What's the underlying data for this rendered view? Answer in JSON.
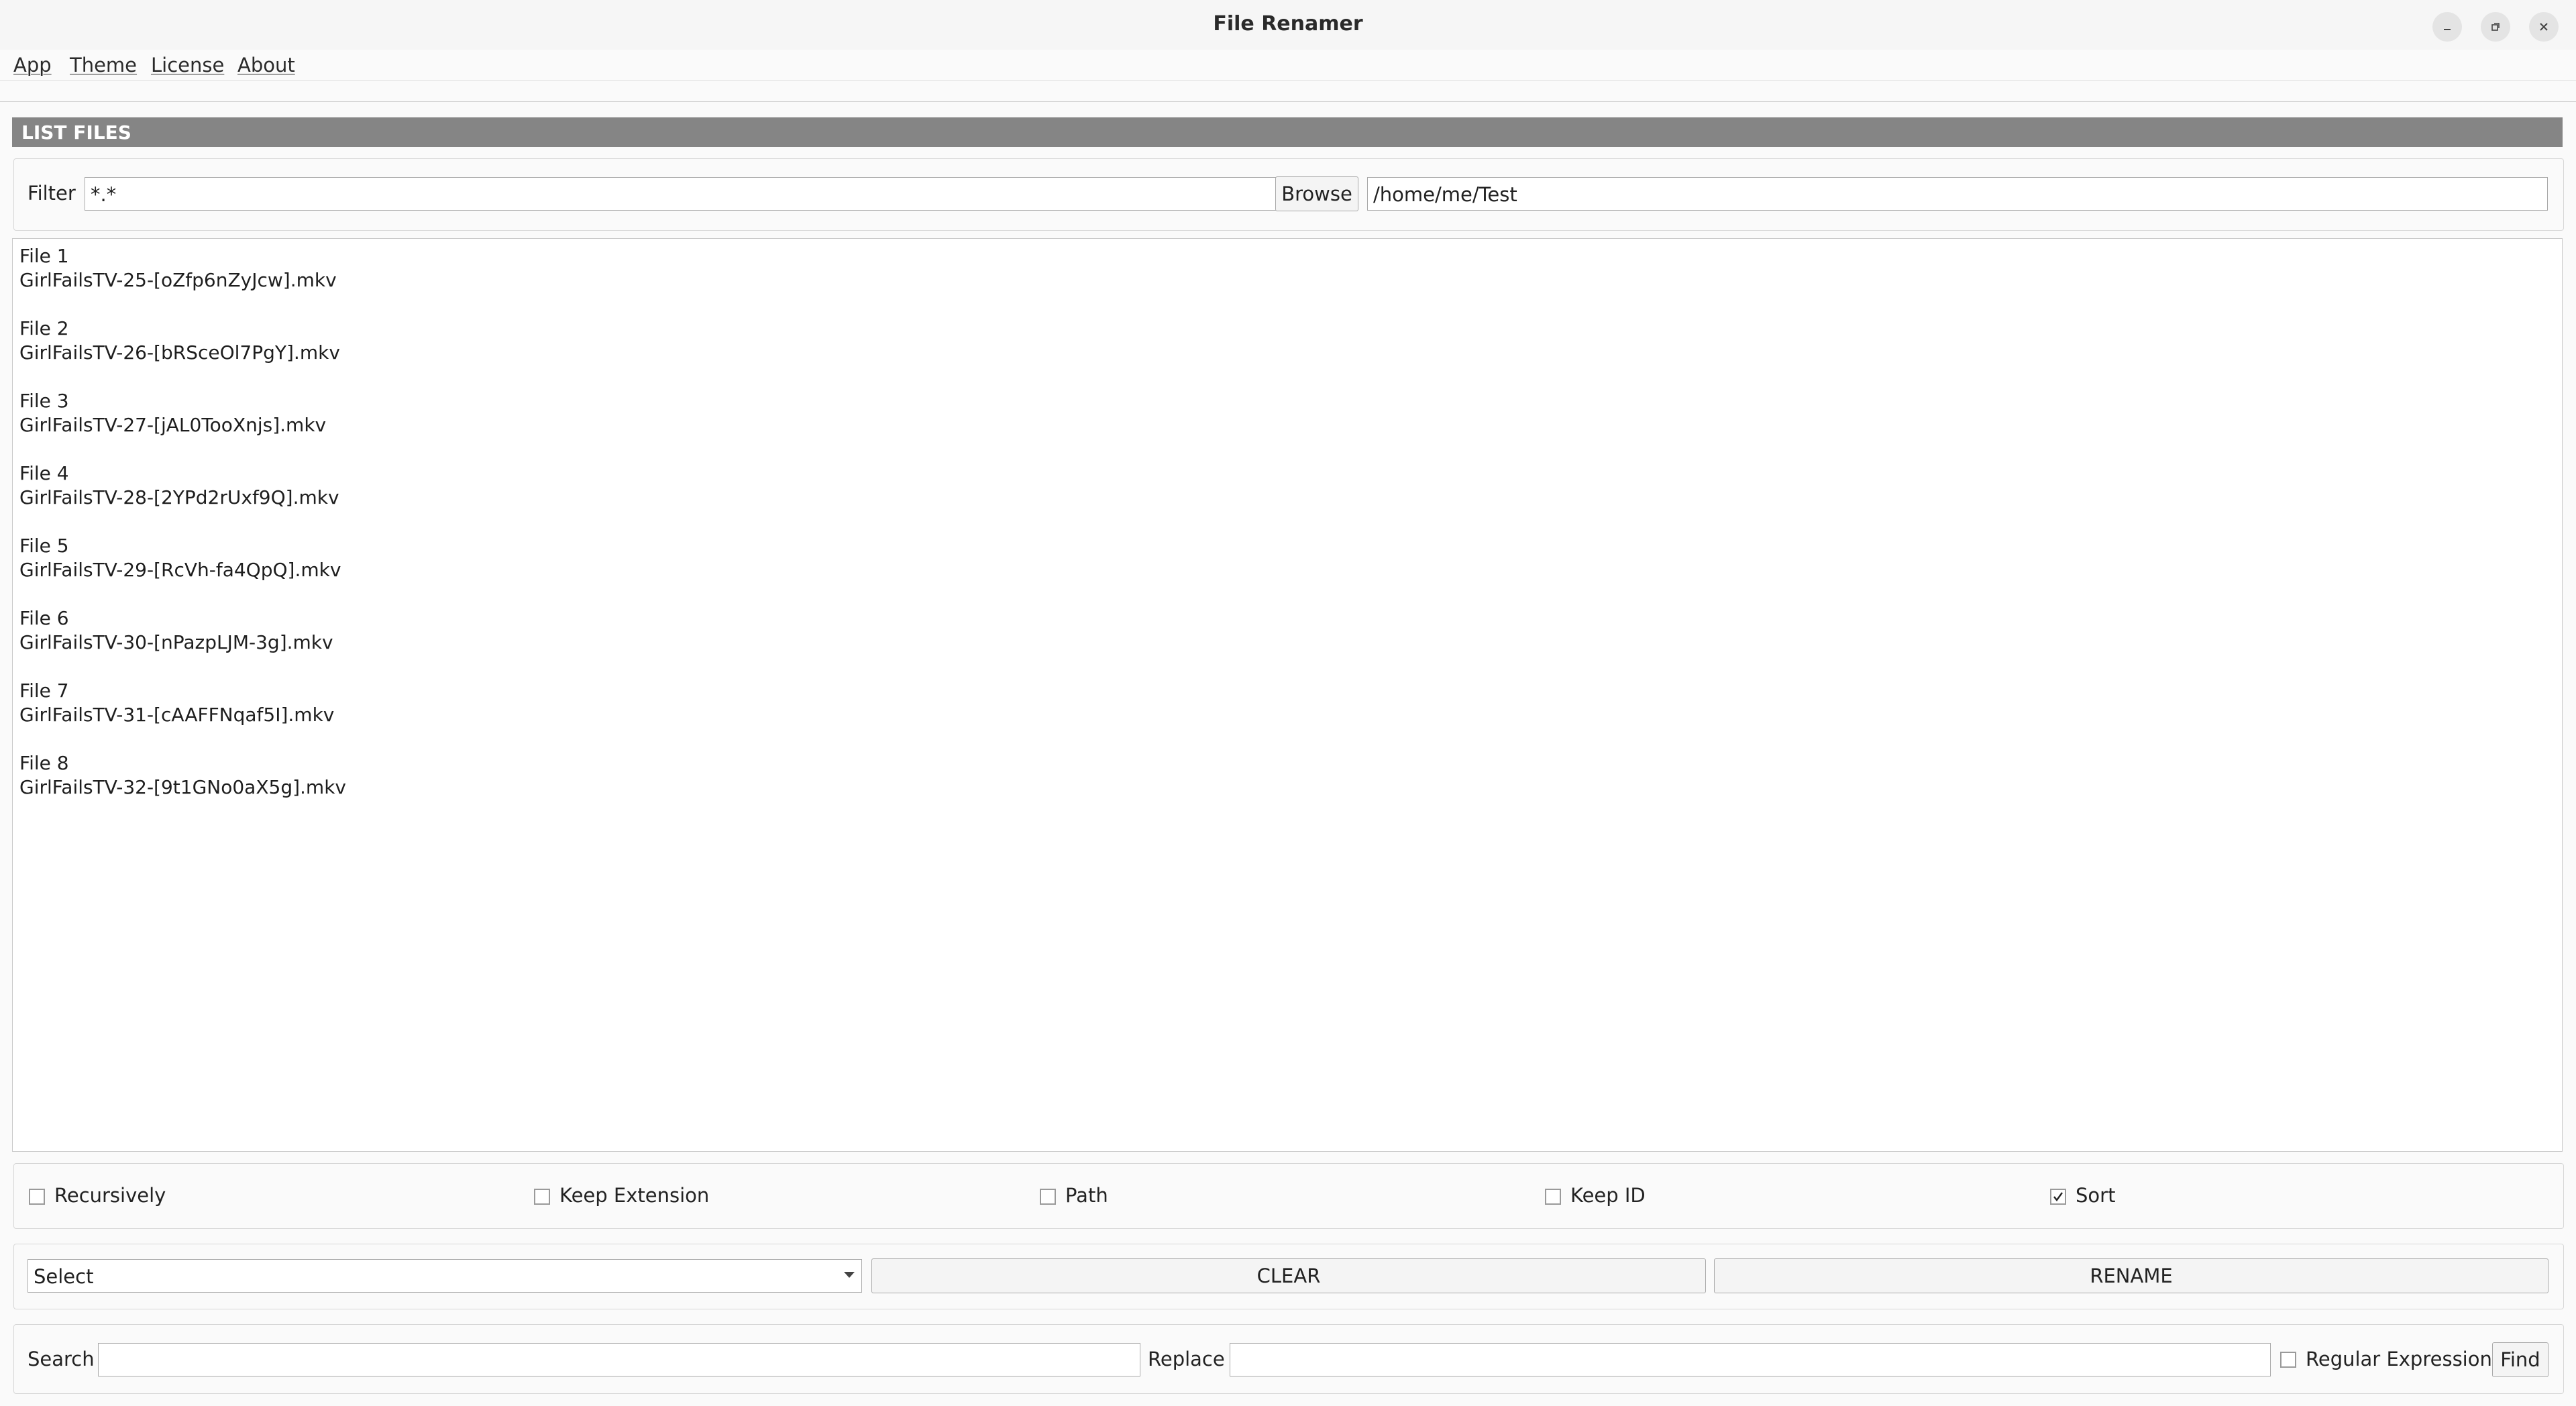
{
  "window": {
    "title": "File Renamer",
    "controls": [
      "minimize-icon",
      "restore-icon",
      "close-icon"
    ]
  },
  "menu": {
    "items": [
      "App",
      "Theme",
      "License",
      "About"
    ]
  },
  "list_files": {
    "header": "LIST FILES",
    "filter_label": "Filter",
    "filter_value": "*.*",
    "browse_label": "Browse",
    "path_value": "/home/me/Test"
  },
  "files": [
    {
      "label": "File 1",
      "name": "GirlFailsTV-25-[oZfp6nZyJcw].mkv"
    },
    {
      "label": "File 2",
      "name": "GirlFailsTV-26-[bRSceOl7PgY].mkv"
    },
    {
      "label": "File 3",
      "name": "GirlFailsTV-27-[jAL0TooXnjs].mkv"
    },
    {
      "label": "File 4",
      "name": "GirlFailsTV-28-[2YPd2rUxf9Q].mkv"
    },
    {
      "label": "File 5",
      "name": "GirlFailsTV-29-[RcVh-fa4QpQ].mkv"
    },
    {
      "label": "File 6",
      "name": "GirlFailsTV-30-[nPazpLJM-3g].mkv"
    },
    {
      "label": "File 7",
      "name": "GirlFailsTV-31-[cAAFFNqaf5I].mkv"
    },
    {
      "label": "File 8",
      "name": "GirlFailsTV-32-[9t1GNo0aX5g].mkv"
    }
  ],
  "options": [
    {
      "label": "Recursively",
      "checked": false
    },
    {
      "label": "Keep Extension",
      "checked": false
    },
    {
      "label": "Path",
      "checked": false
    },
    {
      "label": "Keep ID",
      "checked": false
    },
    {
      "label": "Sort",
      "checked": true
    }
  ],
  "actions": {
    "select_value": "Select",
    "clear_label": "CLEAR",
    "rename_label": "RENAME"
  },
  "search": {
    "search_label": "Search",
    "search_value": "",
    "replace_label": "Replace",
    "replace_value": "",
    "regex_label": "Regular Expression",
    "regex_checked": false,
    "find_label": "Find"
  }
}
